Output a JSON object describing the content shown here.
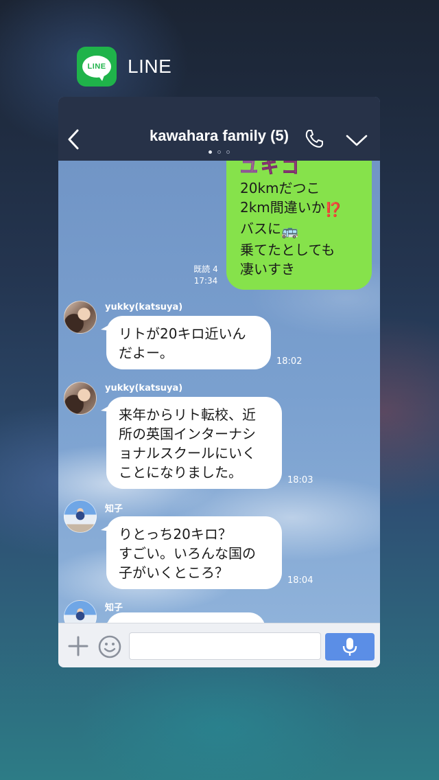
{
  "app": {
    "name": "LINE",
    "icon_text": "LINE"
  },
  "header": {
    "title": "kawahara family (5)",
    "page_dots": 3,
    "active_dot": 0
  },
  "messages": {
    "my_message": {
      "sticker_chars": [
        "ユ",
        "キ",
        "コ"
      ],
      "lines": [
        "20kmだつこ",
        "2km間違いか⁉️",
        "バスに🚌",
        "乗てたとしても",
        "凄いすき"
      ],
      "line2_text": "2km間違いか",
      "line2_emoji": "⁉️",
      "line3_text": "バスに",
      "line3_emoji": "🚌",
      "read_label": "既読 4",
      "time": "17:34"
    },
    "incoming": [
      {
        "sender": "yukky(katsuya)",
        "lines": [
          "リトが20キロ近いん",
          "だよー。"
        ],
        "time": "18:02"
      },
      {
        "sender": "yukky(katsuya)",
        "lines": [
          "来年からリト転校、近",
          "所の英国インターナシ",
          "ョナルスクールにいく",
          "ことになりました。"
        ],
        "time": "18:03"
      },
      {
        "sender": "知子",
        "lines": [
          "りとっち20キロ？",
          "すごい。いろんな国の",
          "子がいくところ？"
        ],
        "time": "18:04"
      },
      {
        "sender": "知子",
        "lines": [],
        "time": ""
      }
    ]
  },
  "input": {
    "value": "",
    "placeholder": ""
  },
  "colors": {
    "topbar": "#273248",
    "my_bubble": "#86e24b",
    "send_button": "#5b8ee6",
    "line_green": "#1fb34a"
  }
}
